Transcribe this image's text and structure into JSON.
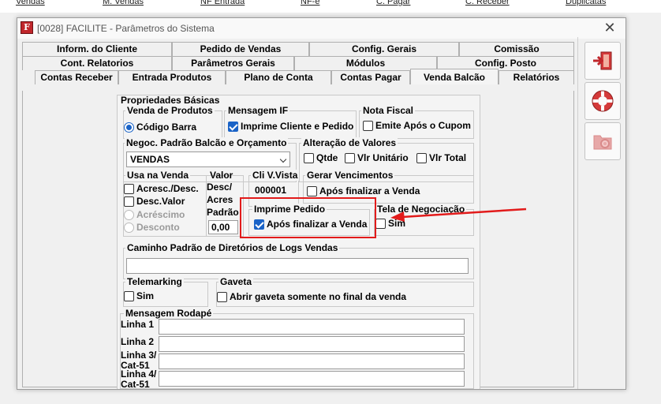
{
  "background_menu": [
    "Vendas",
    "M. Vendas",
    "NF Entrada",
    "NF-e",
    "C. Pagar",
    "C. Receber",
    "Duplicatas"
  ],
  "window": {
    "title": "[0028] FACILITE - Parâmetros do Sistema",
    "icon_letter": "F",
    "close_symbol": "✕"
  },
  "tabs": {
    "row1": [
      "Inform. do Cliente",
      "Pedido de Vendas",
      "Config. Gerais",
      "Comissão"
    ],
    "row2": [
      "Cont. Relatorios",
      "Parâmetros Gerais",
      "Módulos",
      "Config. Posto"
    ],
    "row3": [
      "Contas Receber",
      "Entrada Produtos",
      "Plano de Conta",
      "Contas Pagar",
      "Venda Balcão",
      "Relatórios"
    ],
    "active": "Venda Balcão"
  },
  "form": {
    "propriedades_basicas": "Propriedades Básicas",
    "venda_produtos": {
      "label": "Venda de Produtos",
      "option": "Código Barra",
      "selected": true
    },
    "mensagem_if": {
      "label": "Mensagem IF",
      "checkbox": "Imprime Cliente e Pedido",
      "checked": true
    },
    "nota_fiscal": {
      "label": "Nota Fiscal",
      "checkbox": "Emite Após o Cupom",
      "checked": false
    },
    "negoc": {
      "label": "Negoc. Padrão Balcão e Orçamento",
      "value": "VENDAS"
    },
    "alteracao_valores": {
      "label": "Alteração de Valores",
      "options": [
        "Qtde",
        "Vlr Unitário",
        "Vlr Total"
      ]
    },
    "usa_na_venda": {
      "label": "Usa na Venda",
      "checkboxes": [
        "Acresc./Desc.",
        "Desc.Valor"
      ],
      "radios": [
        "Acréscimo",
        "Desconto"
      ]
    },
    "valor_desc": {
      "label_lines": [
        "Valor",
        "Desc/",
        "Acres",
        "Padrão"
      ],
      "value": "0,00"
    },
    "cli_vista": {
      "label": "Cli V.Vista",
      "value": "000001"
    },
    "gerar_vencimentos": {
      "label": "Gerar Vencimentos",
      "checkbox": "Após finalizar a Venda",
      "checked": false
    },
    "imprime_pedido": {
      "label": "Imprime Pedido",
      "checkbox": "Após finalizar a Venda",
      "checked": true
    },
    "tela_negociacao": {
      "label": "Tela de Negociação",
      "checkbox": "Sim",
      "checked": false
    },
    "caminho": {
      "label": "Caminho Padrão de Diretórios de Logs Vendas",
      "value": ""
    },
    "telemarketing": {
      "label": "Telemarking",
      "checkbox": "Sim",
      "checked": false
    },
    "gaveta": {
      "label": "Gaveta",
      "checkbox": "Abrir gaveta somente no final da venda",
      "checked": false
    },
    "mensagem_rodape": {
      "label": "Mensagem Rodapé",
      "lines": [
        {
          "label": "Linha 1",
          "value": ""
        },
        {
          "label": "Linha 2",
          "value": ""
        },
        {
          "label": "Linha 3/ Cat-51",
          "value": ""
        },
        {
          "label": "Linha 4/ Cat-51",
          "value": ""
        }
      ]
    }
  },
  "toolbar": {
    "buttons": [
      "exit-icon",
      "help-lifebuoy-icon",
      "settings-icon"
    ]
  },
  "colors": {
    "accent": "#1a63c7",
    "annotation": "#e21b1b",
    "exit_red": "#d43a3a",
    "disabled_icon": "#e7a8a8"
  }
}
